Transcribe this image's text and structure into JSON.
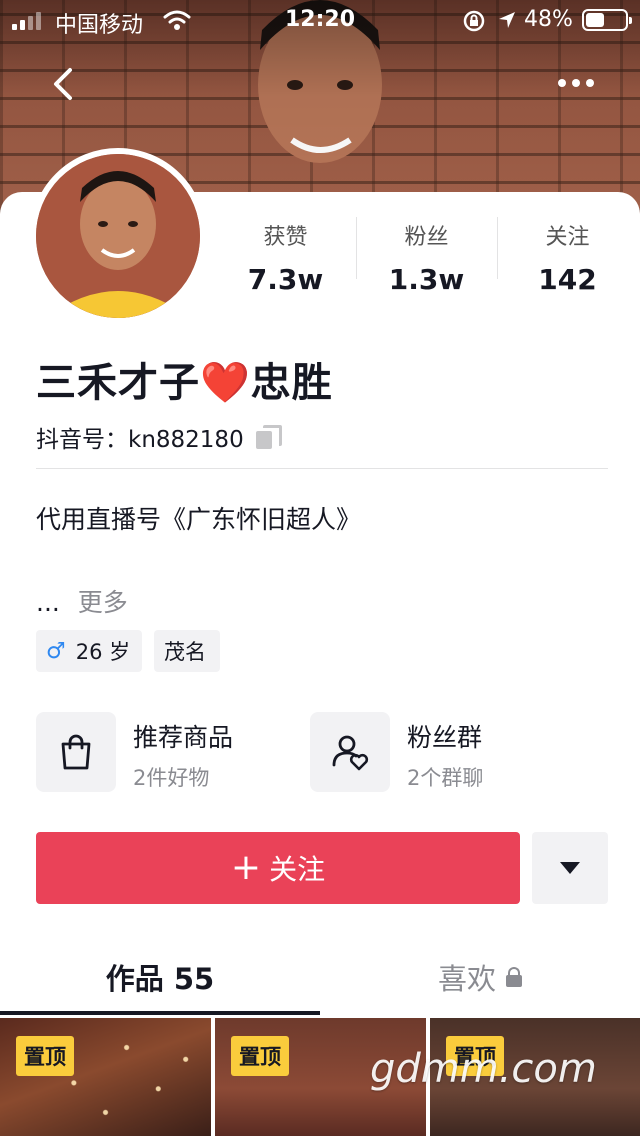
{
  "status_bar": {
    "carrier": "中国移动",
    "time": "12:20",
    "battery": "48%"
  },
  "profile": {
    "nickname": "三禾才子❤️忠胜",
    "douyin_id": "抖音号：kn882180",
    "bio": "代用直播号《广东怀旧超人》",
    "ellipsis": "...",
    "more": "更多"
  },
  "stats": [
    {
      "label": "获赞",
      "value": "7.3w"
    },
    {
      "label": "粉丝",
      "value": "1.3w"
    },
    {
      "label": "关注",
      "value": "142"
    }
  ],
  "tags": {
    "age": "26 岁",
    "city": "茂名"
  },
  "features": {
    "goods_title": "推荐商品",
    "goods_sub": "2件好物",
    "fans_title": "粉丝群",
    "fans_sub": "2个群聊"
  },
  "actions": {
    "follow_label": "关注",
    "follow_color": "#ea4258"
  },
  "tabs": {
    "works": "作品 55",
    "likes": "喜欢"
  },
  "thumbnails": [
    {
      "badge": "置顶"
    },
    {
      "badge": "置顶"
    },
    {
      "badge": "置顶"
    }
  ],
  "watermark": "gdmm.com"
}
